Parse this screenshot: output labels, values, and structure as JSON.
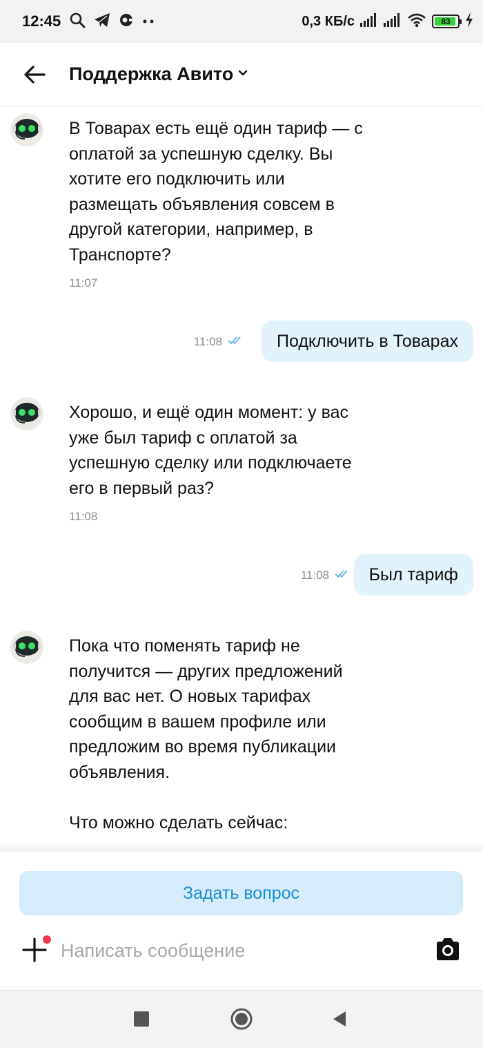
{
  "status_bar": {
    "time": "12:45",
    "left_icons": [
      "search-icon",
      "telegram-icon",
      "notification-icon",
      "more-dots-icon"
    ],
    "speed": "0,3 КБ/с",
    "battery_level": "83",
    "battery_fraction": 0.83,
    "right_icons": [
      "signal-icon",
      "signal-icon",
      "wifi-icon",
      "battery-icon",
      "charging-icon"
    ]
  },
  "header": {
    "title": "Поддержка Авито",
    "back_icon": "arrow-left-icon",
    "dropdown_icon": "chevron-down-icon"
  },
  "messages": [
    {
      "direction": "incoming",
      "lines": [
        "В Товарах есть ещё один тариф — с",
        "оплатой за успешную сделку. Вы",
        "хотите его подключить или",
        "размещать объявления совсем в",
        "другой категории, например, в",
        "Транспорте?"
      ],
      "time": "11:07"
    },
    {
      "direction": "outgoing",
      "text": "Подключить в Товарах",
      "time": "11:08",
      "status_icon": "double-check-icon"
    },
    {
      "direction": "incoming",
      "lines": [
        "Хорошо, и ещё один момент: у вас",
        "уже был тариф с оплатой за",
        "успешную сделку или подключаете",
        "его в первый раз?"
      ],
      "time": "11:08"
    },
    {
      "direction": "outgoing",
      "text": "Был тариф",
      "time": "11:08",
      "status_icon": "double-check-icon"
    },
    {
      "direction": "incoming",
      "lines": [
        "Пока что поменять тариф не",
        "получится — других предложений",
        "для вас нет. О новых тарифах",
        "сообщим в вашем профиле или",
        "предложим во время публикации",
        "объявления.",
        "",
        "Что можно сделать сейчас:"
      ],
      "time": ""
    }
  ],
  "composer": {
    "ask_button": "Задать вопрос",
    "placeholder": "Написать сообщение",
    "plus_icon": "plus-icon",
    "camera_icon": "camera-icon"
  },
  "nav_bar": {
    "buttons": [
      "recents-square-icon",
      "home-circle-icon",
      "back-triangle-icon"
    ]
  },
  "colors": {
    "accent": "#1a8ed2",
    "outgoing_bubble": "#e3f3fc",
    "ask_button_bg": "#d7ecfb",
    "timestamp": "#8c8c8c",
    "notification_dot": "#ef3b4c",
    "battery_green": "#3ad23a",
    "read_check": "#5bb6e8"
  }
}
